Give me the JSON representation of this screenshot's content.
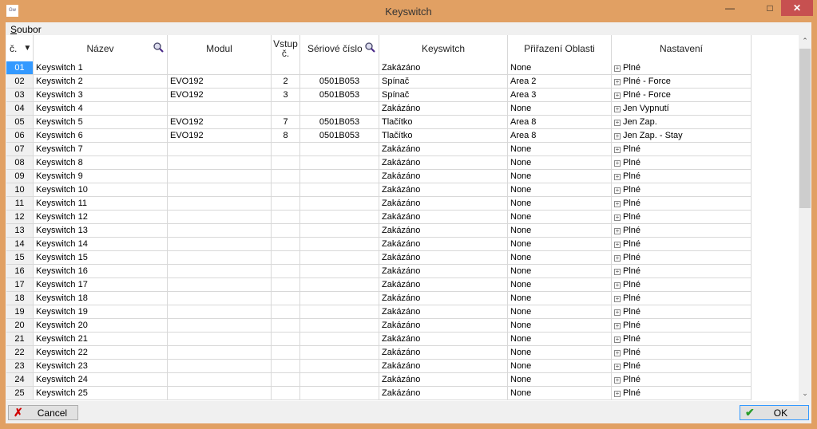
{
  "window": {
    "title": "Keyswitch",
    "app_icon": "Gw"
  },
  "menu": {
    "file_accel": "S",
    "file_rest": "oubor"
  },
  "columns": {
    "num": "č.",
    "name": "Název",
    "module": "Modul",
    "input_l1": "Vstup",
    "input_l2": "č.",
    "serial": "Sériové číslo",
    "keyswitch": "Keyswitch",
    "area": "Přiřazení Oblasti",
    "settings": "Nastavení"
  },
  "rows": [
    [
      "01",
      "Keyswitch 1",
      "",
      "",
      "",
      "Zakázáno",
      "None",
      "Plné"
    ],
    [
      "02",
      "Keyswitch 2",
      "EVO192",
      "2",
      "0501B053",
      "Spínač",
      "Area 2",
      "Plné - Force"
    ],
    [
      "03",
      "Keyswitch 3",
      "EVO192",
      "3",
      "0501B053",
      "Spínač",
      "Area 3",
      "Plné - Force"
    ],
    [
      "04",
      "Keyswitch 4",
      "",
      "",
      "",
      "Zakázáno",
      "None",
      "Jen Vypnutí"
    ],
    [
      "05",
      "Keyswitch 5",
      "EVO192",
      "7",
      "0501B053",
      "Tlačítko",
      "Area 8",
      "Jen Zap."
    ],
    [
      "06",
      "Keyswitch 6",
      "EVO192",
      "8",
      "0501B053",
      "Tlačítko",
      "Area 8",
      "Jen Zap. - Stay"
    ],
    [
      "07",
      "Keyswitch 7",
      "",
      "",
      "",
      "Zakázáno",
      "None",
      "Plné"
    ],
    [
      "08",
      "Keyswitch 8",
      "",
      "",
      "",
      "Zakázáno",
      "None",
      "Plné"
    ],
    [
      "09",
      "Keyswitch 9",
      "",
      "",
      "",
      "Zakázáno",
      "None",
      "Plné"
    ],
    [
      "10",
      "Keyswitch 10",
      "",
      "",
      "",
      "Zakázáno",
      "None",
      "Plné"
    ],
    [
      "11",
      "Keyswitch 11",
      "",
      "",
      "",
      "Zakázáno",
      "None",
      "Plné"
    ],
    [
      "12",
      "Keyswitch 12",
      "",
      "",
      "",
      "Zakázáno",
      "None",
      "Plné"
    ],
    [
      "13",
      "Keyswitch 13",
      "",
      "",
      "",
      "Zakázáno",
      "None",
      "Plné"
    ],
    [
      "14",
      "Keyswitch 14",
      "",
      "",
      "",
      "Zakázáno",
      "None",
      "Plné"
    ],
    [
      "15",
      "Keyswitch 15",
      "",
      "",
      "",
      "Zakázáno",
      "None",
      "Plné"
    ],
    [
      "16",
      "Keyswitch 16",
      "",
      "",
      "",
      "Zakázáno",
      "None",
      "Plné"
    ],
    [
      "17",
      "Keyswitch 17",
      "",
      "",
      "",
      "Zakázáno",
      "None",
      "Plné"
    ],
    [
      "18",
      "Keyswitch 18",
      "",
      "",
      "",
      "Zakázáno",
      "None",
      "Plné"
    ],
    [
      "19",
      "Keyswitch 19",
      "",
      "",
      "",
      "Zakázáno",
      "None",
      "Plné"
    ],
    [
      "20",
      "Keyswitch 20",
      "",
      "",
      "",
      "Zakázáno",
      "None",
      "Plné"
    ],
    [
      "21",
      "Keyswitch 21",
      "",
      "",
      "",
      "Zakázáno",
      "None",
      "Plné"
    ],
    [
      "22",
      "Keyswitch 22",
      "",
      "",
      "",
      "Zakázáno",
      "None",
      "Plné"
    ],
    [
      "23",
      "Keyswitch 23",
      "",
      "",
      "",
      "Zakázáno",
      "None",
      "Plné"
    ],
    [
      "24",
      "Keyswitch 24",
      "",
      "",
      "",
      "Zakázáno",
      "None",
      "Plné"
    ],
    [
      "25",
      "Keyswitch 25",
      "",
      "",
      "",
      "Zakázáno",
      "None",
      "Plné"
    ]
  ],
  "selected_row": "01",
  "buttons": {
    "cancel": "Cancel",
    "ok": "OK"
  },
  "colors": {
    "window_border": "#e1a063",
    "selection": "#3399ff",
    "cancel_icon": "#d00000",
    "ok_icon": "#2a9d2a"
  }
}
